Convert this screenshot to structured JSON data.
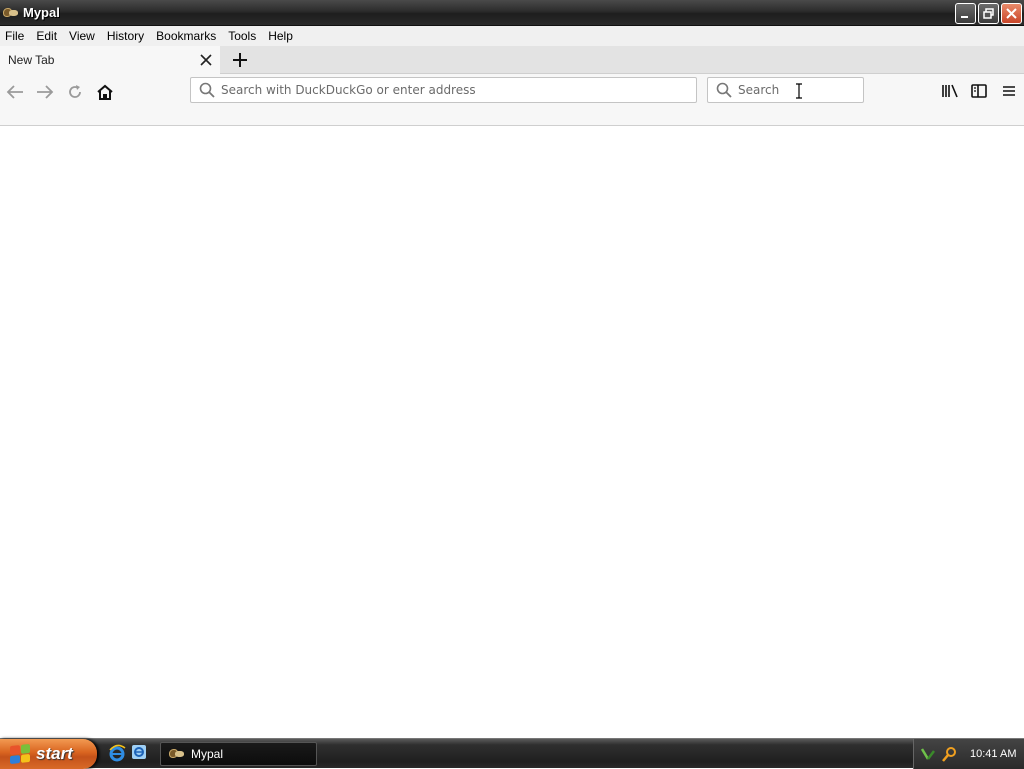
{
  "window": {
    "title": "Mypal",
    "app_icon": "mypal-icon"
  },
  "menu": [
    "File",
    "Edit",
    "View",
    "History",
    "Bookmarks",
    "Tools",
    "Help"
  ],
  "tabs": [
    {
      "label": "New Tab",
      "active": true
    }
  ],
  "urlbar": {
    "placeholder": "Search with DuckDuckGo or enter address",
    "value": ""
  },
  "searchbar": {
    "placeholder": "Search",
    "value": ""
  },
  "taskbar": {
    "start_label": "start",
    "task_item": "Mypal",
    "clock": "10:41 AM"
  },
  "colors": {
    "start_orange": "#d9641f",
    "taskbar_dark": "#1f1f1f",
    "toolbar": "#f7f7f7"
  }
}
